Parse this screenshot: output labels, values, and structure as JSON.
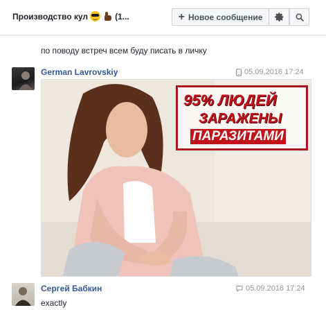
{
  "header": {
    "chat_title": "Производство кул",
    "chat_title_suffix": "(1...",
    "title_emojis": [
      "sunglasses-emoji",
      "thumbs-up-emoji"
    ],
    "new_message_label": "Новое сообщение",
    "plus_symbol": "+",
    "icons": [
      "plus-icon",
      "gear-icon",
      "search-icon"
    ]
  },
  "messages": [
    {
      "text": "по поводу встреч всем буду писать в личку"
    },
    {
      "sender": "German Lavrovskiy",
      "timestamp": "05.09.2016 17:24",
      "time_icon": "phone-icon",
      "image": {
        "ad_line_1": "95% ЛЮДЕЙ",
        "ad_line_2": "ЗАРАЖЕНЫ",
        "ad_line_3": "ПАРАЗИТАМИ"
      }
    },
    {
      "sender": "Сергей Бабкин",
      "timestamp": "05.09.2016 17:24",
      "time_icon": "chat-bubble-icon",
      "text": "exactly"
    }
  ],
  "colors": {
    "link": "#365899",
    "muted": "#90949c",
    "ad_red": "#c1121b"
  }
}
